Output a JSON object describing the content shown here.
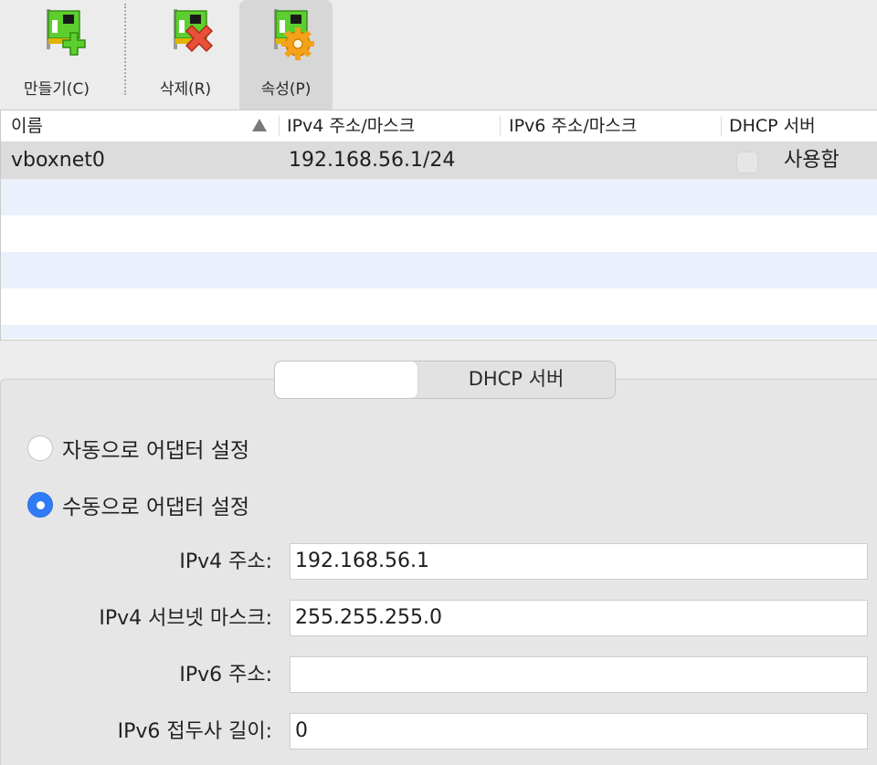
{
  "toolbar": {
    "create_label": "만들기(C)",
    "delete_label": "삭제(R)",
    "properties_label": "속성(P)"
  },
  "list": {
    "columns": [
      "이름",
      "IPv4 주소/마스크",
      "IPv6 주소/마스크",
      "DHCP 서버"
    ],
    "rows": [
      {
        "name": "vboxnet0",
        "ipv4": "192.168.56.1/24",
        "ipv6": "",
        "dhcp_label": "사용함",
        "dhcp_enabled": false
      }
    ]
  },
  "details": {
    "tabs": [
      "",
      "DHCP 서버"
    ],
    "radio_auto_label": "자동으로 어댑터 설정",
    "radio_manual_label": "수동으로 어댑터 설정",
    "selected_mode": "manual",
    "ipv4_address_label": "IPv4 주소:",
    "ipv4_address_value": "192.168.56.1",
    "ipv4_mask_label": "IPv4 서브넷 마스크:",
    "ipv4_mask_value": "255.255.255.0",
    "ipv6_address_label": "IPv6 주소:",
    "ipv6_address_value": "",
    "ipv6_prefix_label": "IPv6 접두사 길이:",
    "ipv6_prefix_value": "0"
  },
  "colors": {
    "accent": "#2f7cf6",
    "selected_row": "#dcdcdc",
    "alt_row": "#eaf1fc",
    "icon_green": "#5ccf2e"
  }
}
